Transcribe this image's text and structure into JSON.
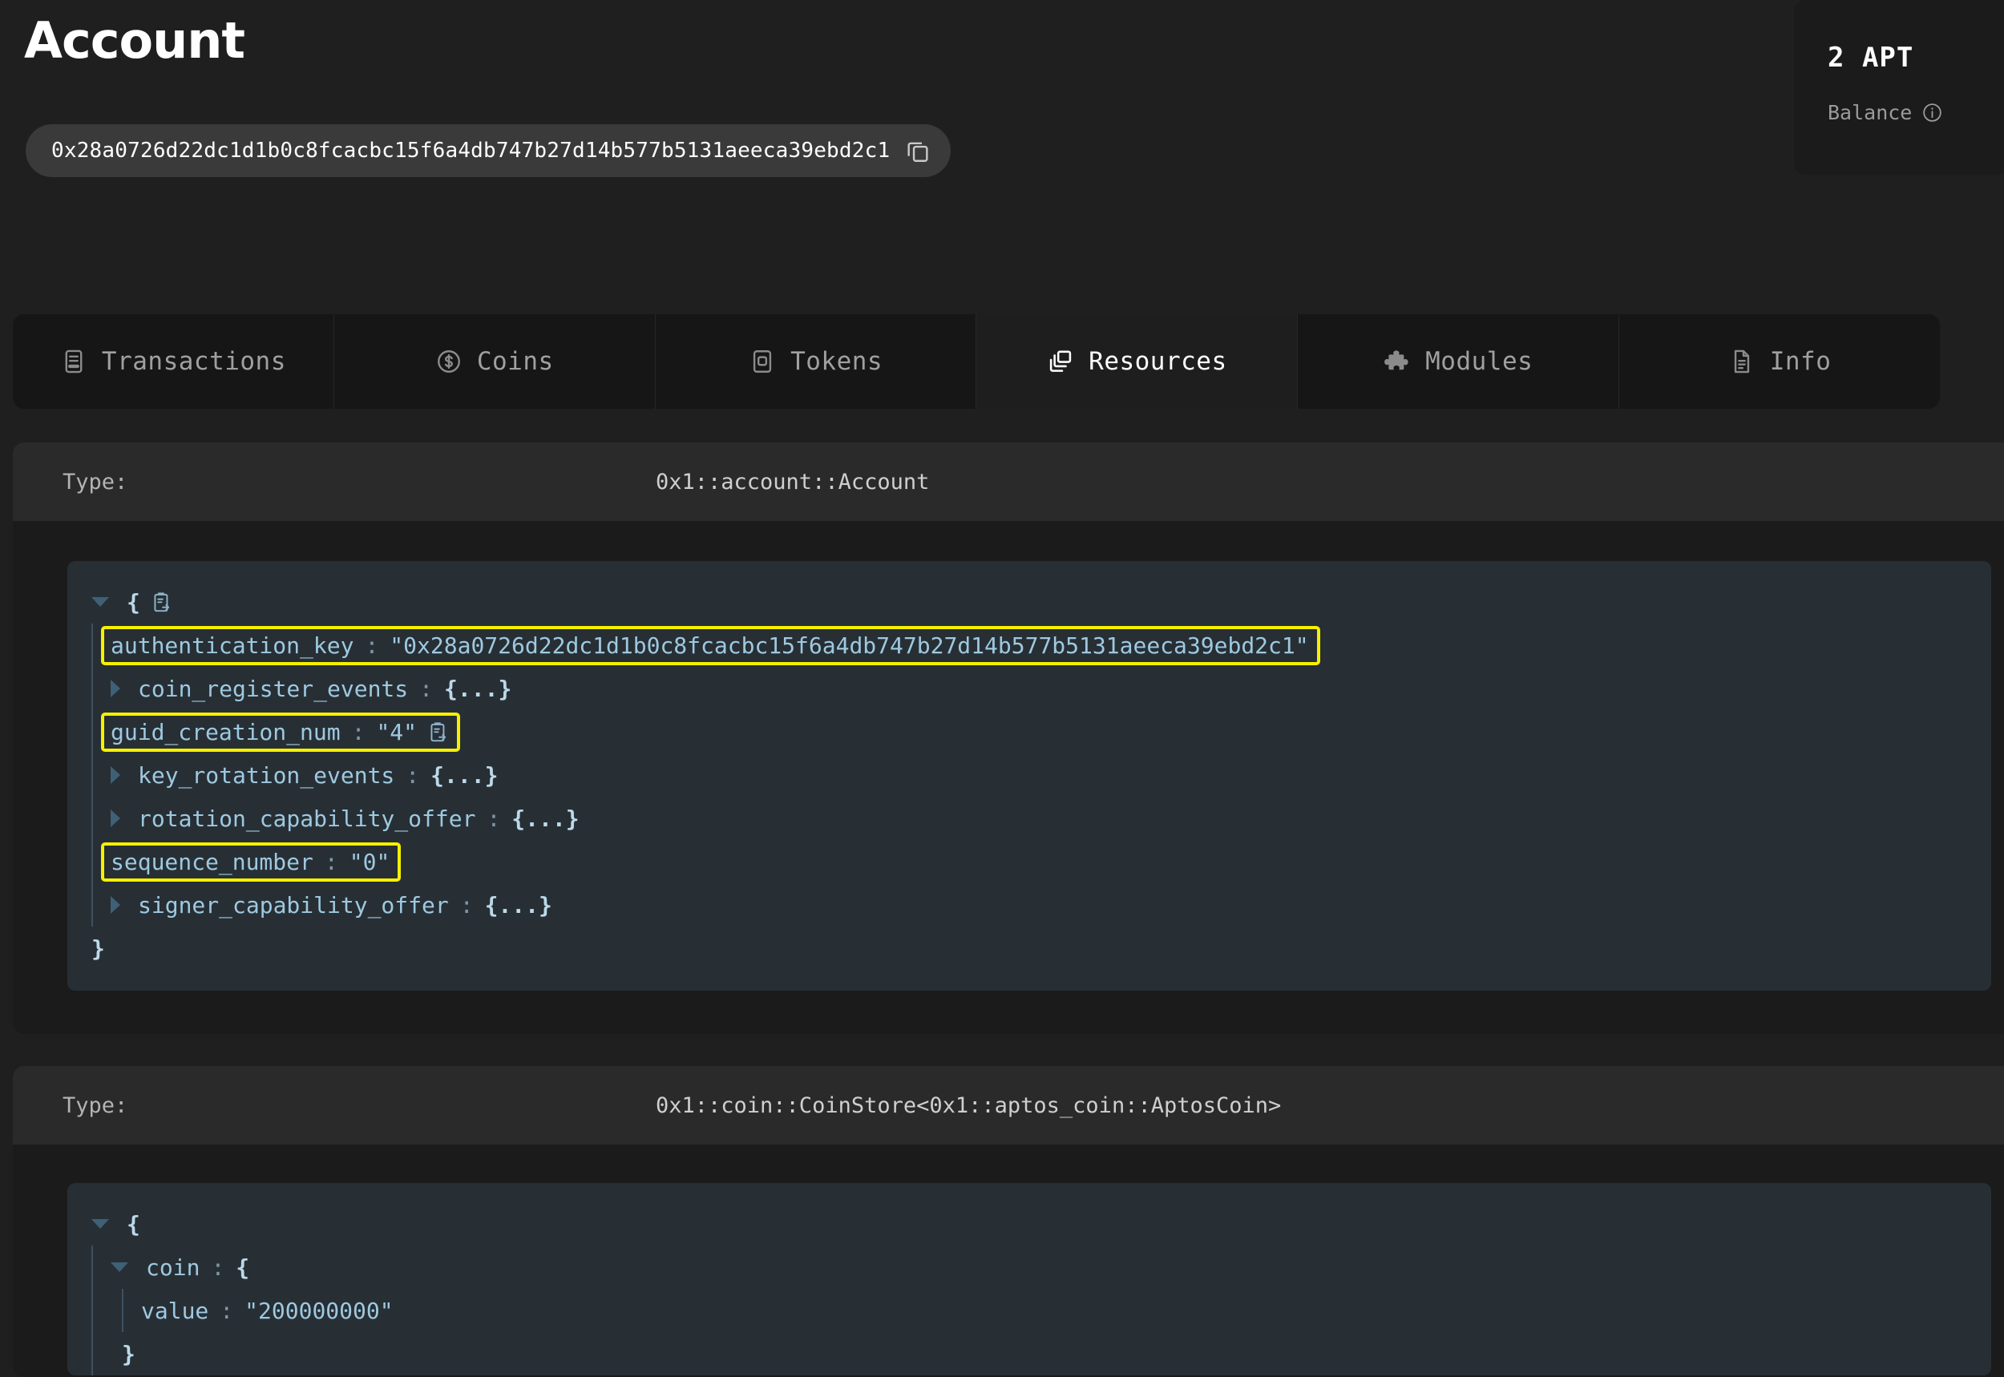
{
  "header": {
    "title": "Account",
    "address": "0x28a0726d22dc1d1b0c8fcacbc15f6a4db747b27d14b577b5131aeeca39ebd2c1",
    "copy_icon": "copy-icon"
  },
  "balance": {
    "amount": "2 APT",
    "label": "Balance",
    "info_icon": "info-icon"
  },
  "tabs": [
    {
      "label": "Transactions",
      "icon": "receipt-icon",
      "active": false
    },
    {
      "label": "Coins",
      "icon": "dollar-circle-icon",
      "active": false
    },
    {
      "label": "Tokens",
      "icon": "token-card-icon",
      "active": false
    },
    {
      "label": "Resources",
      "icon": "stacked-windows-icon",
      "active": true
    },
    {
      "label": "Modules",
      "icon": "puzzle-piece-icon",
      "active": false
    },
    {
      "label": "Info",
      "icon": "document-icon",
      "active": false
    }
  ],
  "resources": [
    {
      "type_label": "Type:",
      "type_value": "0x1::account::Account",
      "json": {
        "open_brace": "{",
        "close_brace": "}",
        "rows": [
          {
            "key": "authentication_key",
            "colon": ":",
            "value": "\"0x28a0726d22dc1d1b0c8fcacbc15f6a4db747b27d14b577b5131aeeca39ebd2c1\"",
            "highlighted": true,
            "collapsible": false,
            "copy": false
          },
          {
            "key": "coin_register_events",
            "colon": ":",
            "value": "{...}",
            "highlighted": false,
            "collapsible": true,
            "copy": false
          },
          {
            "key": "guid_creation_num",
            "colon": ":",
            "value": "\"4\"",
            "highlighted": true,
            "collapsible": false,
            "copy": true
          },
          {
            "key": "key_rotation_events",
            "colon": ":",
            "value": "{...}",
            "highlighted": false,
            "collapsible": true,
            "copy": false
          },
          {
            "key": "rotation_capability_offer",
            "colon": ":",
            "value": "{...}",
            "highlighted": false,
            "collapsible": true,
            "copy": false
          },
          {
            "key": "sequence_number",
            "colon": ":",
            "value": "\"0\"",
            "highlighted": true,
            "collapsible": false,
            "copy": false
          },
          {
            "key": "signer_capability_offer",
            "colon": ":",
            "value": "{...}",
            "highlighted": false,
            "collapsible": true,
            "copy": false
          }
        ]
      }
    },
    {
      "type_label": "Type:",
      "type_value": "0x1::coin::CoinStore<0x1::aptos_coin::AptosCoin>",
      "json": {
        "open_brace": "{",
        "coin_key": "coin",
        "coin_colon": ":",
        "coin_open_brace": "{",
        "value_key": "value",
        "value_colon": ":",
        "value_value": "\"200000000\"",
        "coin_close_brace": "}"
      }
    }
  ],
  "colors": {
    "page_background": "#1f1f1f",
    "card_background": "#1b1b1b",
    "type_row_background": "#2a2a2a",
    "json_background": "#272f35",
    "highlight": "#f5f000",
    "json_text": "#9ec9e0",
    "active_tab_text": "#ffffff"
  }
}
